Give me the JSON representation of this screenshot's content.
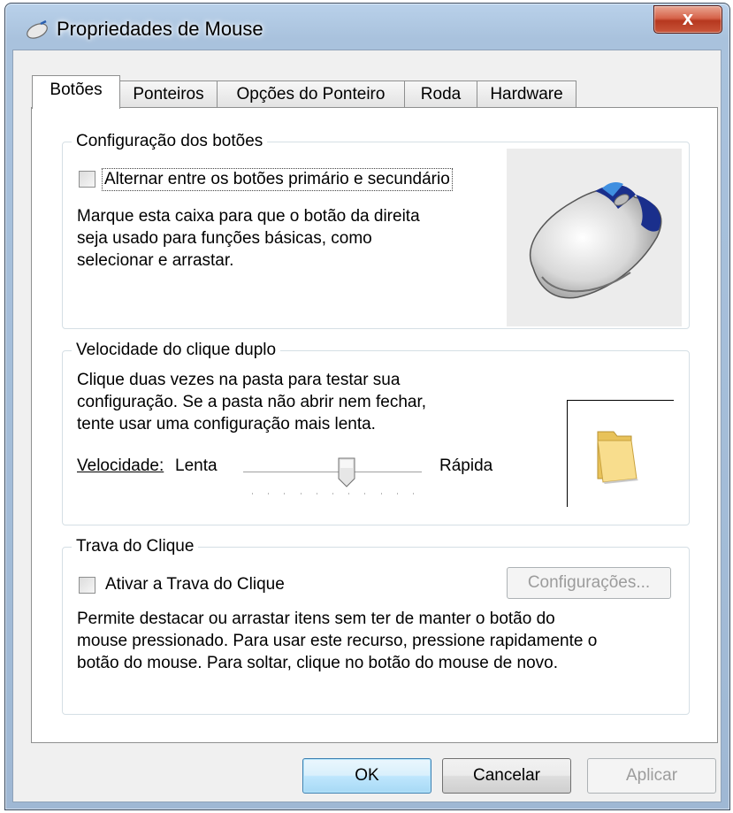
{
  "window": {
    "title": "Propriedades de Mouse",
    "close_label": "x"
  },
  "tabs": [
    {
      "label": "Botões",
      "active": true
    },
    {
      "label": "Ponteiros",
      "active": false
    },
    {
      "label": "Opções do Ponteiro",
      "active": false
    },
    {
      "label": "Roda",
      "active": false
    },
    {
      "label": "Hardware",
      "active": false
    }
  ],
  "button_config": {
    "group_label": "Configuração dos botões",
    "checkbox_label": "Alternar entre os botões primário e secundário",
    "checked": false,
    "description": [
      "Marque esta caixa para que o botão da direita",
      "seja usado para funções básicas, como",
      "selecionar e arrastar."
    ]
  },
  "double_click": {
    "group_label": "Velocidade do clique duplo",
    "description": [
      "Clique duas vezes na pasta para testar sua",
      "configuração.  Se a pasta não abrir nem fechar,",
      "tente usar uma configuração mais lenta."
    ],
    "speed_label": "Velocidade:",
    "slow_label": "Lenta",
    "fast_label": "Rápida",
    "slider_level": 0.58
  },
  "click_lock": {
    "group_label": "Trava do Clique",
    "checkbox_label": "Ativar a Trava do Clique",
    "checked": false,
    "settings_button": "Configurações...",
    "description": [
      "Permite destacar ou arrastar itens sem ter de manter o botão do",
      "mouse pressionado. Para usar este recurso, pressione rapidamente o",
      "botão do mouse. Para soltar, clique no botão do mouse de novo."
    ]
  },
  "footer": {
    "ok": "OK",
    "cancel": "Cancelar",
    "apply": "Aplicar"
  },
  "colors": {
    "titlebar": "#b9d1ea",
    "close_button": "#c9553a",
    "default_button": "#bee6fd"
  },
  "icons": [
    "mouse-app-icon",
    "mouse-illustration",
    "folder-icon"
  ]
}
